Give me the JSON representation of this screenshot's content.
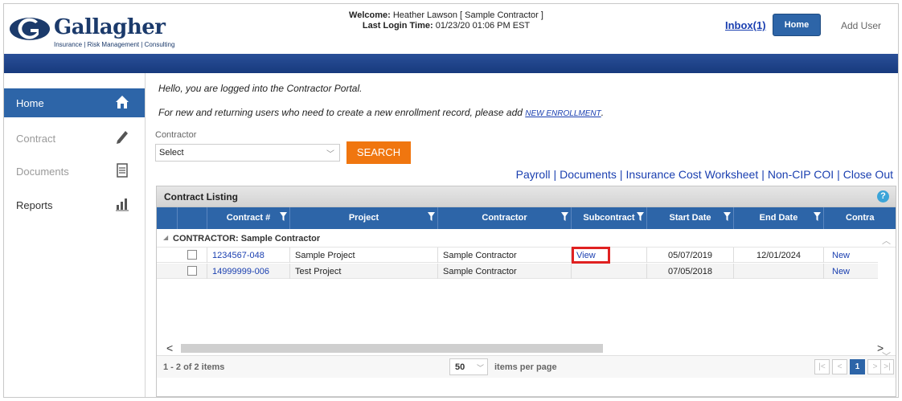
{
  "header": {
    "logo_text": "Gallagher",
    "logo_tagline": "Insurance | Risk Management | Consulting",
    "welcome_label": "Welcome:",
    "welcome_value": "Heather Lawson [ Sample Contractor ]",
    "login_label": "Last Login Time:",
    "login_value": "01/23/20 01:06 PM EST",
    "inbox_label": "Inbox(1)",
    "home_label": "Home",
    "add_user_label": "Add User"
  },
  "sidebar": {
    "items": [
      {
        "label": "Home",
        "icon": "home-icon",
        "active": true
      },
      {
        "label": "Contract",
        "icon": "pencil-icon"
      },
      {
        "label": "Documents",
        "icon": "document-icon"
      },
      {
        "label": "Reports",
        "icon": "bar-chart-icon"
      }
    ]
  },
  "main": {
    "hello_text": "Hello, you are logged into the Contractor Portal.",
    "new_users_text": "For new and returning users who need to create a new enrollment record, please add ",
    "new_enrollment_link": "NEW ENROLLMENT",
    "new_users_suffix": ".",
    "contractor_label": "Contractor",
    "contractor_select_value": "Select",
    "search_label": "SEARCH",
    "quick_links": [
      "Payroll",
      "Documents",
      "Insurance Cost Worksheet",
      "Non-CIP COI",
      "Close Out"
    ],
    "quick_sep": "|"
  },
  "grid": {
    "title": "Contract Listing",
    "help_icon": "help-icon",
    "columns": [
      "Contract #",
      "Project",
      "Contractor",
      "Subcontract",
      "Start Date",
      "End Date",
      "Contra"
    ],
    "group_label": "CONTRACTOR: Sample Contractor",
    "rows": [
      {
        "contract": "1234567-048",
        "project": "Sample Project",
        "contractor": "Sample Contractor",
        "subcontract": "View",
        "start": "05/07/2019",
        "end": "12/01/2024",
        "last": "New"
      },
      {
        "contract": "14999999-006",
        "project": "Test Project",
        "contractor": "Sample Contractor",
        "subcontract": "",
        "start": "07/05/2018",
        "end": "",
        "last": "New"
      }
    ],
    "pager": {
      "count_text": "1 - 2 of 2 items",
      "page_size": "50",
      "items_per_page": "items per page",
      "current_page": "1"
    }
  },
  "colors": {
    "brand_blue": "#2d65a8",
    "header_bar": "#173a7d",
    "search_orange": "#f0760f",
    "link_blue": "#1a3fb0",
    "highlight_red": "#e02121"
  }
}
